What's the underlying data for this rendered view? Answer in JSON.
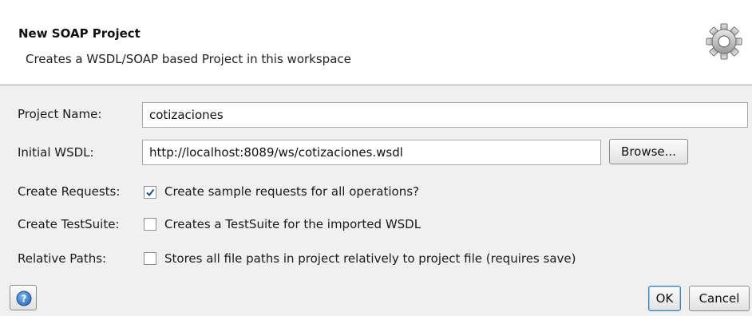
{
  "header": {
    "title": "New SOAP Project",
    "subtitle": "Creates a WSDL/SOAP based Project in this workspace",
    "icon": "gear-icon"
  },
  "form": {
    "project_name": {
      "label": "Project Name:",
      "value": "cotizaciones"
    },
    "initial_wsdl": {
      "label": "Initial WSDL:",
      "value": "http://localhost:8089/ws/cotizaciones.wsdl",
      "browse_label": "Browse..."
    },
    "create_requests": {
      "label": "Create Requests:",
      "checked": true,
      "text": "Create sample requests for all operations?"
    },
    "create_testsuite": {
      "label": "Create TestSuite:",
      "checked": false,
      "text": "Creates a TestSuite for the imported WSDL"
    },
    "relative_paths": {
      "label": "Relative Paths:",
      "checked": false,
      "text": "Stores all file paths in project relatively to project file (requires save)"
    }
  },
  "footer": {
    "help_icon": "help-icon",
    "ok_label": "OK",
    "cancel_label": "Cancel"
  },
  "colors": {
    "help_blue": "#2a6ebd",
    "check_blue": "#1f4f9c"
  }
}
